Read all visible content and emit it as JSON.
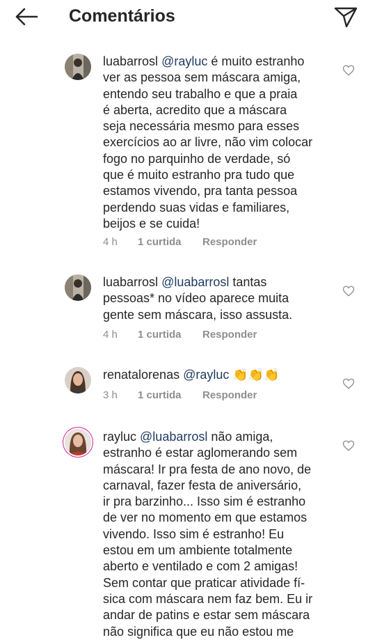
{
  "header": {
    "title": "Comentários",
    "back_icon": "arrow-left-icon",
    "send_icon": "paper-plane-icon"
  },
  "comments": [
    {
      "username": "luabarrosl",
      "mention": "@rayluc",
      "text": " é muito estranho\nver as pessoa sem máscara amiga,\nentendo seu trabalho e que a praia\né aberta, acredito que a máscara\nseja necessária mesmo para esses\nexercícios ao ar livre, não vim colocar\nfogo no parquinho de verdade, só\nque é muito estranho pra tudo que\nestamos vivendo, pra tanta pessoa\nperdendo suas vidas e familiares,\nbeijos e se cuida!",
      "time": "4 h",
      "likes": "1 curtida",
      "reply": "Responder"
    },
    {
      "username": "luabarrosl",
      "mention": "@luabarrosl",
      "text": " tantas\npessoas* no vídeo aparece muita\ngente sem máscara, isso assusta.",
      "time": "4 h",
      "likes": "1 curtida",
      "reply": "Responder"
    },
    {
      "username": "renatalorenas",
      "mention": "@rayluc",
      "text": " 👏👏👏",
      "time": "3 h",
      "likes": "1 curtida",
      "reply": "Responder"
    },
    {
      "username": "rayluc",
      "mention": "@luabarrosl",
      "text": " não amiga,\nestranho é estar aglomerando sem\nmáscara! Ir pra festa de ano novo, de\ncarnaval, fazer festa de aniversário,\nir pra barzinho... Isso sim é estranho\nde ver no momento em que estamos\nvivendo. Isso sim é estranho! Eu\nestou em um ambiente totalmente\naberto e ventilado e com 2 amigas!\nSem contar que praticar atividade fí-\nsica com máscara nem faz bem. Eu ir\nandar de patins e estar sem máscara\nnão significa que eu não estou me"
    }
  ],
  "colors": {
    "text": "#262626",
    "secondary": "#8e8e8e",
    "mention": "#1f3a5f",
    "background": "#ffffff"
  }
}
